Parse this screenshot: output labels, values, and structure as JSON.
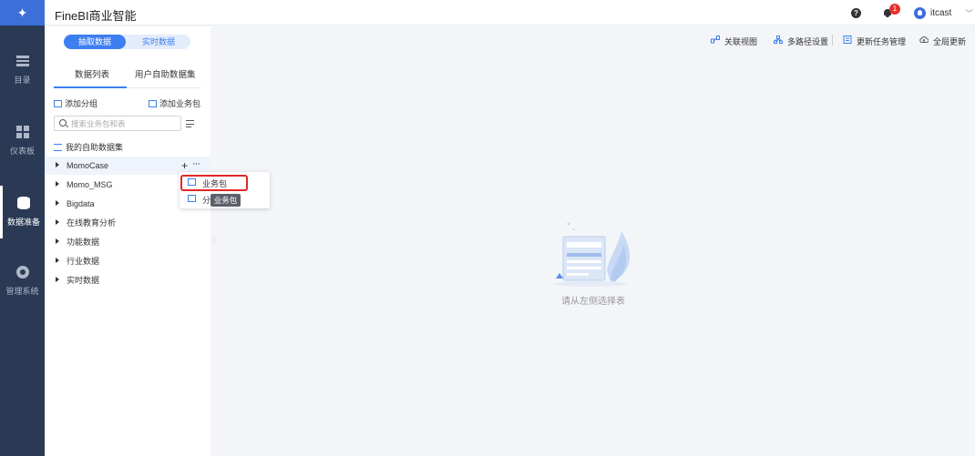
{
  "app": {
    "title": "FineBI商业智能"
  },
  "user": {
    "name": "itcast",
    "notifications": "1"
  },
  "nav": {
    "items": [
      {
        "label": "目录",
        "icon": "list-icon",
        "active": false
      },
      {
        "label": "仪表板",
        "icon": "dashboard-icon",
        "active": false
      },
      {
        "label": "数据准备",
        "icon": "database-icon",
        "active": true
      },
      {
        "label": "管理系统",
        "icon": "gear-icon",
        "active": false
      }
    ]
  },
  "segment": {
    "extract": "抽取数据",
    "realtime": "实时数据"
  },
  "tabs": {
    "data_list": "数据列表",
    "self_dataset": "用户自助数据集"
  },
  "actions": {
    "add_group": "添加分组",
    "add_package": "添加业务包"
  },
  "search": {
    "placeholder": "搜索业务包和表"
  },
  "tree": {
    "my_dataset": "我的自助数据集",
    "items": [
      "MomoCase",
      "Momo_MSG",
      "Bigdata",
      "在线教育分析",
      "功能数据",
      "行业数据",
      "实时数据"
    ]
  },
  "row_actions": {
    "add": "+",
    "more": "···"
  },
  "context_menu": {
    "items": [
      "业务包",
      "分"
    ]
  },
  "tooltip": "业务包",
  "toolbar": {
    "relation_view": "关联视图",
    "multipath": "多路径设置",
    "update_task": "更新任务管理",
    "global_update": "全局更新"
  },
  "empty_state": {
    "text": "请从左侧选择表"
  },
  "colors": {
    "accent": "#3d7ff0",
    "nav_bg": "#2a3a55",
    "highlight_border": "#e02828"
  }
}
